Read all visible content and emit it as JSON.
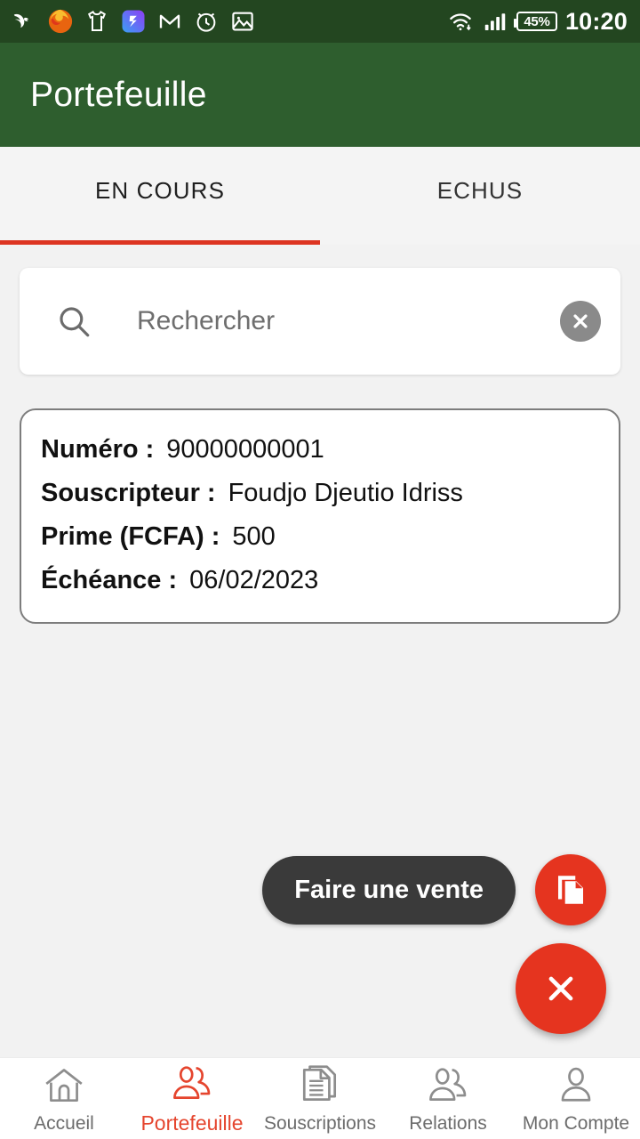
{
  "status_bar": {
    "time": "10:20",
    "battery": "45%",
    "icons": [
      "bird-app-icon",
      "firefox-icon",
      "tshirt-icon",
      "blue-app-icon",
      "gmail-icon",
      "alarm-clock-icon",
      "gallery-icon"
    ],
    "right_icons": [
      "wifi-icon",
      "signal-icon",
      "battery-icon"
    ],
    "colors": {
      "background": "#234620",
      "foreground": "#ffffff"
    }
  },
  "app_bar": {
    "title": "Portefeuille",
    "background": "#2e5e2e"
  },
  "tabs": {
    "items": [
      {
        "label": "EN COURS",
        "active": true
      },
      {
        "label": "ECHUS",
        "active": false
      }
    ],
    "indicator_color": "#dd3522"
  },
  "search": {
    "placeholder": "Rechercher",
    "value": "",
    "icon": "search-icon",
    "clear_icon": "close-circle-icon"
  },
  "policy_card": {
    "rows": [
      {
        "label": "Numéro  :",
        "value": "90000000001"
      },
      {
        "label": "Souscripteur  :",
        "value": "Foudjo Djeutio Idriss"
      },
      {
        "label": "Prime (FCFA) :",
        "value": "500"
      },
      {
        "label": "Échéance :",
        "value": "06/02/2023"
      }
    ]
  },
  "fab": {
    "mini_label": "Faire une vente",
    "mini_icon": "copy-documents-icon",
    "main_icon": "close-icon",
    "color": "#e5341f",
    "label_background": "#3a3a3a"
  },
  "bottom_nav": {
    "items": [
      {
        "label": "Accueil",
        "icon": "home-icon",
        "active": false
      },
      {
        "label": "Portefeuille",
        "icon": "two-people-icon",
        "active": true
      },
      {
        "label": "Souscriptions",
        "icon": "documents-icon",
        "active": false
      },
      {
        "label": "Relations",
        "icon": "two-people-icon",
        "active": false
      },
      {
        "label": "Mon Compte",
        "icon": "person-icon",
        "active": false
      }
    ],
    "active_color": "#e5452e",
    "inactive_color": "#6c6c6c"
  }
}
